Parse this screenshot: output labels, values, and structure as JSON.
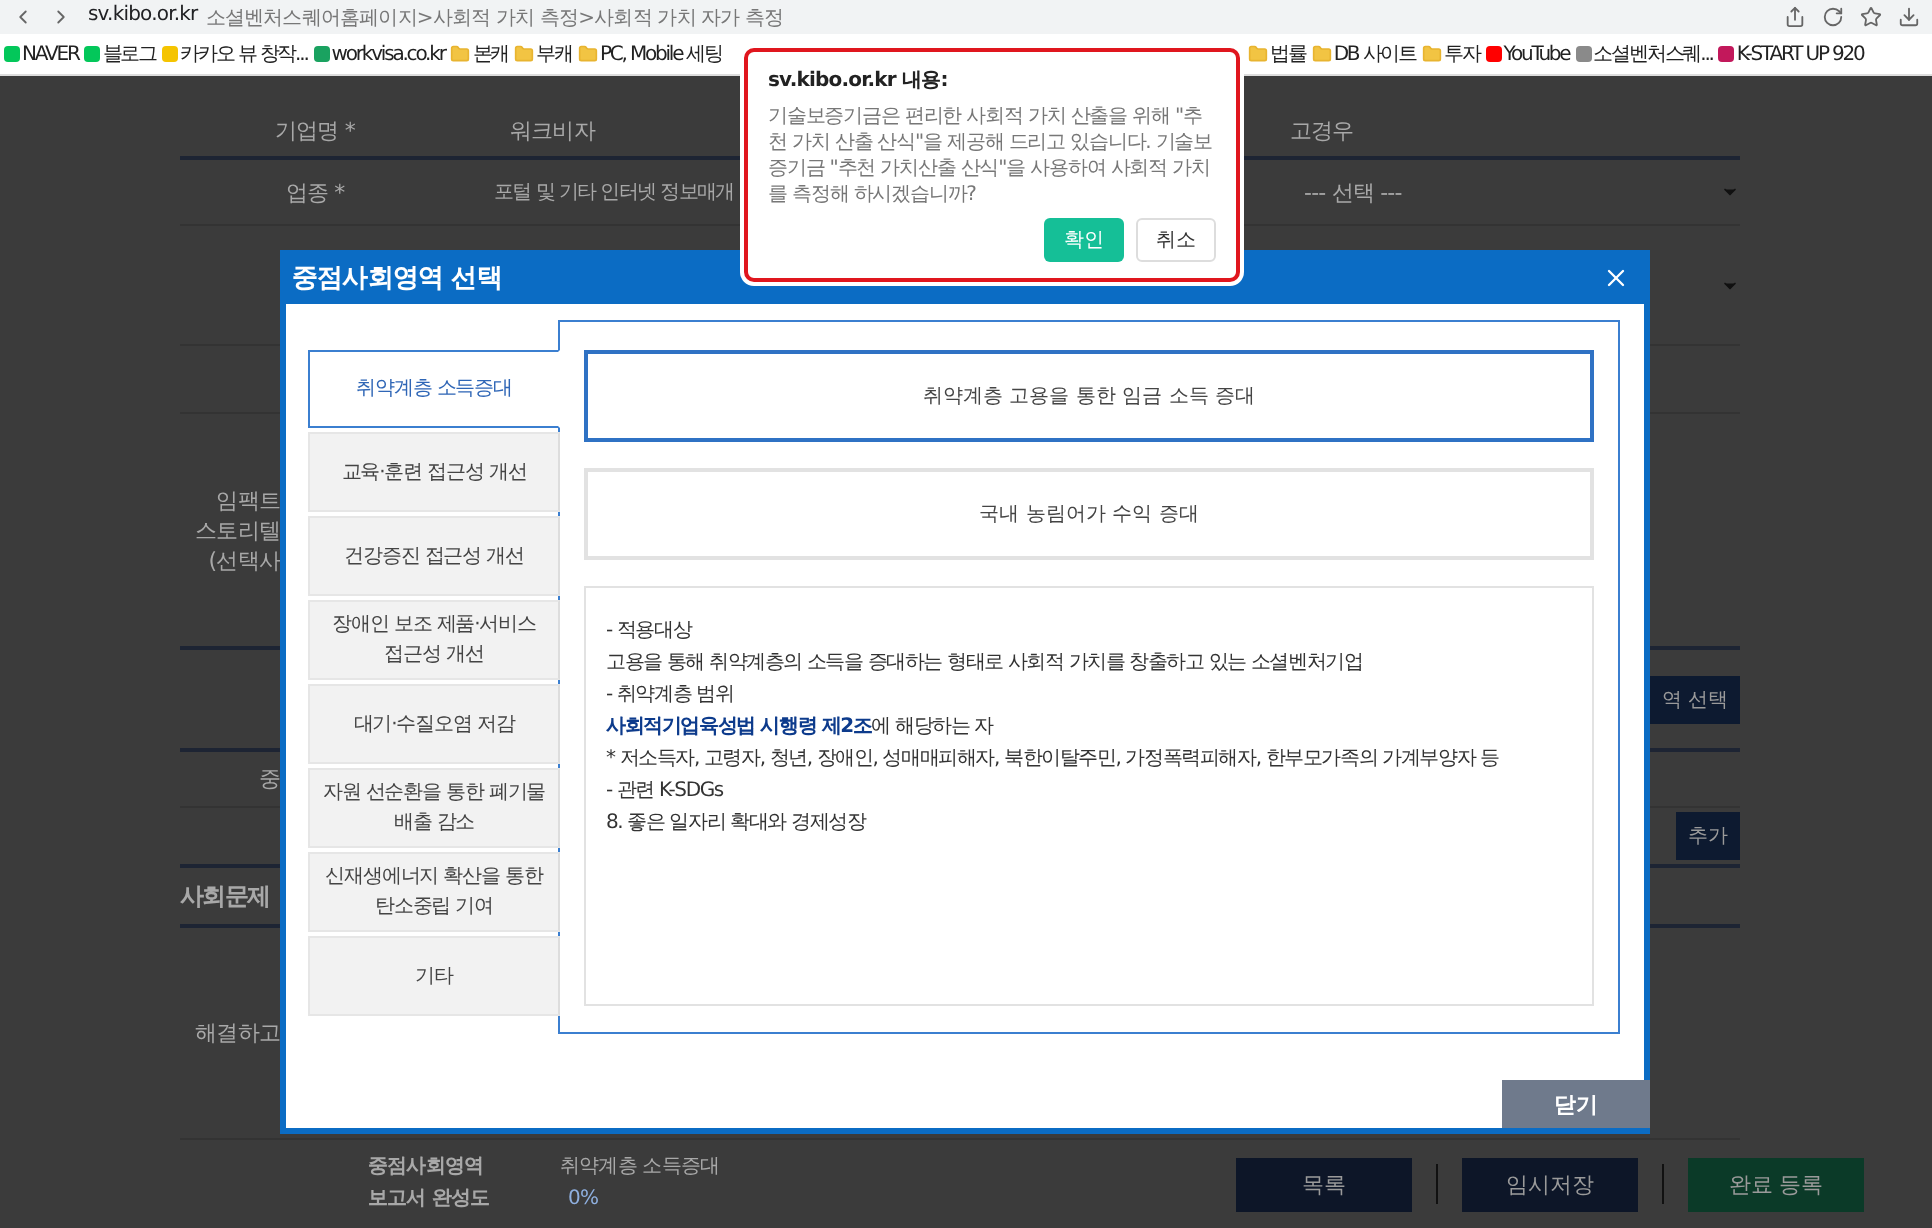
{
  "browser": {
    "domain": "sv.kibo.or.kr",
    "path": "소셜벤처스퀘어홈페이지>사회적 가치 측정>사회적 가치 자가 측정",
    "bookmarks": [
      {
        "label": "NAVER",
        "kind": "site",
        "color": "#03c75a"
      },
      {
        "label": "블로그",
        "kind": "site",
        "color": "#03c75a"
      },
      {
        "label": "카카오 뷰 창작...",
        "kind": "site",
        "color": "#f5c400"
      },
      {
        "label": "workvisa.co.kr",
        "kind": "site",
        "color": "#1aa260"
      },
      {
        "label": "본캐",
        "kind": "folder"
      },
      {
        "label": "부캐",
        "kind": "folder"
      },
      {
        "label": "PC, Mobile 세팅",
        "kind": "folder"
      }
    ],
    "bookmarks_right": [
      {
        "label": "법률",
        "kind": "folder"
      },
      {
        "label": "DB 사이트",
        "kind": "folder"
      },
      {
        "label": "투자",
        "kind": "folder"
      },
      {
        "label": "YouTube",
        "kind": "site",
        "color": "#ff0000"
      },
      {
        "label": "소셜벤처스퀘...",
        "kind": "site",
        "color": "#8a8a8a"
      },
      {
        "label": "K-START UP 920",
        "kind": "site",
        "color": "#c2185b"
      }
    ]
  },
  "form": {
    "company": {
      "label": "기업명 *",
      "value": "워크비자",
      "column_3": "고경우"
    },
    "industry": {
      "label": "업종 *",
      "value": "포털 및 기타 인터넷 정보매개",
      "select": "--- 선택 ---"
    },
    "impact_label": [
      "임팩트",
      "스토리텔",
      "(선택사"
    ],
    "area_button": "역 선택",
    "row_label": "중",
    "add_button": "추가",
    "section_heading": "사회문제",
    "solve_label": "해결하고"
  },
  "footer": {
    "summary": [
      {
        "label": "중점사회영역",
        "value": "취약계층 소득증대",
        "kind": "text"
      },
      {
        "label": "보고서 완성도",
        "value": "0%",
        "kind": "percent"
      }
    ],
    "actions": [
      {
        "label": "목록",
        "kind": "primary"
      },
      {
        "label": "임시저장",
        "kind": "primary"
      },
      {
        "label": "완료 등록",
        "kind": "success"
      }
    ]
  },
  "modal": {
    "title": "중점사회영역 선택",
    "categories": [
      {
        "label": "취약계층 소득증대",
        "selected": true
      },
      {
        "label": "교육·훈련 접근성 개선",
        "selected": false
      },
      {
        "label": "건강증진 접근성 개선",
        "selected": false
      },
      {
        "label": "장애인 보조 제품·서비스 접근성 개선",
        "selected": false
      },
      {
        "label": "대기·수질오염 저감",
        "selected": false
      },
      {
        "label": "자원 선순환을 통한 폐기물 배출 감소",
        "selected": false
      },
      {
        "label": "신재생에너지 확산을 통한 탄소중립 기여",
        "selected": false
      },
      {
        "label": "기타",
        "selected": false
      }
    ],
    "options": [
      {
        "label": "취약계층 고용을 통한 임금 소득 증대",
        "selected": true
      },
      {
        "label": "국내 농림어가 수익 증대",
        "selected": false
      }
    ],
    "description": [
      "- 적용대상",
      "고용을 통해 취약계층의 소득을 증대하는 형태로 사회적 가치를 창출하고 있는 소셜벤처기업",
      "- 취약계층 범위",
      "**사회적기업육성법 시행령 제2조**에 해당하는 자",
      "* 저소득자, 고령자, 청년, 장애인, 성매매피해자, 북한이탈주민, 가정폭력피해자, 한부모가족의 가계부양자 등",
      "- 관련 K-SDGs",
      "8. 좋은 일자리 확대와 경제성장"
    ],
    "close": "닫기"
  },
  "alert": {
    "title": "sv.kibo.or.kr 내용:",
    "message": "기술보증기금은 편리한 사회적 가치 산출을 위해 \"추천 가치 산출 산식\"을 제공해 드리고 있습니다. 기술보증기금 \"추천 가치산출 산식\"을 사용하여 사회적 가치를 측정해 하시겠습니까?",
    "buttons": [
      {
        "label": "확인",
        "kind": "primary"
      },
      {
        "label": "취소",
        "kind": "secondary"
      }
    ]
  }
}
